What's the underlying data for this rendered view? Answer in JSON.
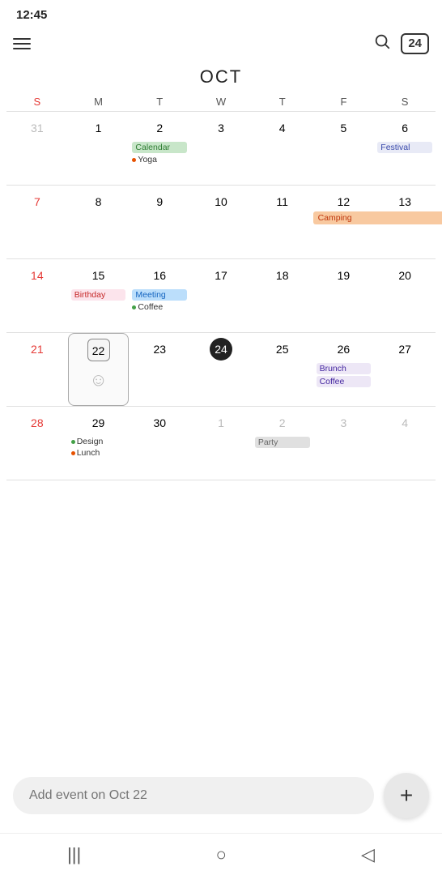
{
  "statusBar": {
    "time": "12:45"
  },
  "toolbar": {
    "searchLabel": "Search",
    "dateLabel": "24"
  },
  "calendar": {
    "monthTitle": "OCT",
    "dayHeaders": [
      "S",
      "M",
      "T",
      "W",
      "T",
      "F",
      "S"
    ],
    "weeks": [
      {
        "days": [
          {
            "num": "31",
            "type": "other-month"
          },
          {
            "num": "1",
            "type": "normal"
          },
          {
            "num": "2",
            "type": "normal",
            "events": [
              {
                "label": "Calendar",
                "style": "green-bg"
              },
              {
                "label": "Yoga",
                "style": "dot-orange"
              }
            ]
          },
          {
            "num": "3",
            "type": "normal"
          },
          {
            "num": "4",
            "type": "normal"
          },
          {
            "num": "5",
            "type": "normal"
          },
          {
            "num": "6",
            "type": "normal",
            "events": [
              {
                "label": "Festival",
                "style": "festival"
              }
            ]
          }
        ]
      },
      {
        "days": [
          {
            "num": "7",
            "type": "sunday"
          },
          {
            "num": "8",
            "type": "normal"
          },
          {
            "num": "9",
            "type": "normal"
          },
          {
            "num": "10",
            "type": "normal"
          },
          {
            "num": "11",
            "type": "normal"
          },
          {
            "num": "12",
            "type": "normal",
            "events": [
              {
                "label": "Camping",
                "style": "orange-bg",
                "span": true
              }
            ]
          },
          {
            "num": "13",
            "type": "normal"
          }
        ]
      },
      {
        "days": [
          {
            "num": "14",
            "type": "sunday"
          },
          {
            "num": "15",
            "type": "normal",
            "events": [
              {
                "label": "Birthday",
                "style": "birthday"
              }
            ]
          },
          {
            "num": "16",
            "type": "normal",
            "events": [
              {
                "label": "Meeting",
                "style": "blue-bg"
              },
              {
                "label": "Coffee",
                "style": "dot-green"
              }
            ]
          },
          {
            "num": "17",
            "type": "normal"
          },
          {
            "num": "18",
            "type": "normal"
          },
          {
            "num": "19",
            "type": "normal"
          },
          {
            "num": "20",
            "type": "normal"
          }
        ]
      },
      {
        "days": [
          {
            "num": "21",
            "type": "sunday"
          },
          {
            "num": "22",
            "type": "selected",
            "smiley": true
          },
          {
            "num": "23",
            "type": "normal"
          },
          {
            "num": "24",
            "type": "today"
          },
          {
            "num": "25",
            "type": "normal"
          },
          {
            "num": "26",
            "type": "normal",
            "events": [
              {
                "label": "Brunch",
                "style": "purple"
              },
              {
                "label": "Coffee",
                "style": "purple"
              }
            ]
          },
          {
            "num": "27",
            "type": "normal"
          }
        ]
      },
      {
        "days": [
          {
            "num": "28",
            "type": "sunday"
          },
          {
            "num": "29",
            "type": "normal",
            "events": [
              {
                "label": "Design",
                "style": "dot-green"
              },
              {
                "label": "Lunch",
                "style": "dot-orange"
              }
            ]
          },
          {
            "num": "30",
            "type": "normal"
          },
          {
            "num": "1",
            "type": "other-month"
          },
          {
            "num": "2",
            "type": "other-month",
            "events": [
              {
                "label": "Party",
                "style": "party"
              }
            ]
          },
          {
            "num": "3",
            "type": "other-month"
          },
          {
            "num": "4",
            "type": "other-month"
          }
        ]
      }
    ]
  },
  "bottomBar": {
    "placeholder": "Add event on Oct 22",
    "fabIcon": "+"
  },
  "bottomNav": {
    "icons": [
      "|||",
      "○",
      "◁"
    ]
  }
}
